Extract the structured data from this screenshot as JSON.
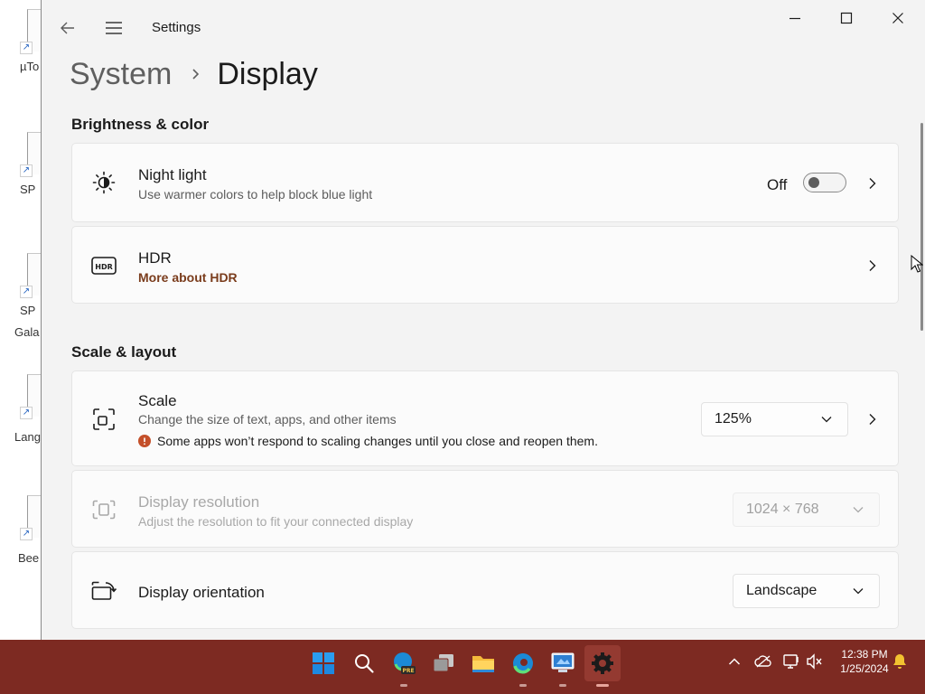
{
  "desktop": {
    "icons": [
      {
        "label": "µTo",
        "label2": ""
      },
      {
        "label": "SP",
        "label2": ""
      },
      {
        "label": "SP",
        "label2": "Gala"
      },
      {
        "label": "Lang",
        "label2": ""
      },
      {
        "label": "Bee",
        "label2": ""
      }
    ]
  },
  "window": {
    "title": "Settings",
    "breadcrumb": {
      "parent": "System",
      "current": "Display"
    }
  },
  "sections": {
    "brightness": {
      "heading": "Brightness & color"
    },
    "scale": {
      "heading": "Scale & layout"
    }
  },
  "night_light": {
    "title": "Night light",
    "subtitle": "Use warmer colors to help block blue light",
    "state_label": "Off",
    "enabled": false
  },
  "hdr": {
    "title": "HDR",
    "link": "More about HDR"
  },
  "scale": {
    "title": "Scale",
    "subtitle": "Change the size of text, apps, and other items",
    "warning": "Some apps won’t respond to scaling changes until you close and reopen them.",
    "value": "125%"
  },
  "resolution": {
    "title": "Display resolution",
    "subtitle": "Adjust the resolution to fit your connected display",
    "value": "1024 × 768",
    "disabled": true
  },
  "orientation": {
    "title": "Display orientation",
    "value": "Landscape"
  },
  "taskbar": {
    "apps": [
      "start-icon",
      "search-icon",
      "edge-beta-icon",
      "task-view-icon",
      "file-explorer-icon",
      "edge-icon",
      "remote-desktop-icon",
      "settings-icon"
    ],
    "time": "12:38 PM",
    "date": "1/25/2024"
  },
  "colors": {
    "taskbar": "#7d2a22",
    "window_bg": "#f3f3f3",
    "card_bg": "#fbfbfb",
    "link": "#7a3c1c",
    "warning": "#c4502a"
  }
}
